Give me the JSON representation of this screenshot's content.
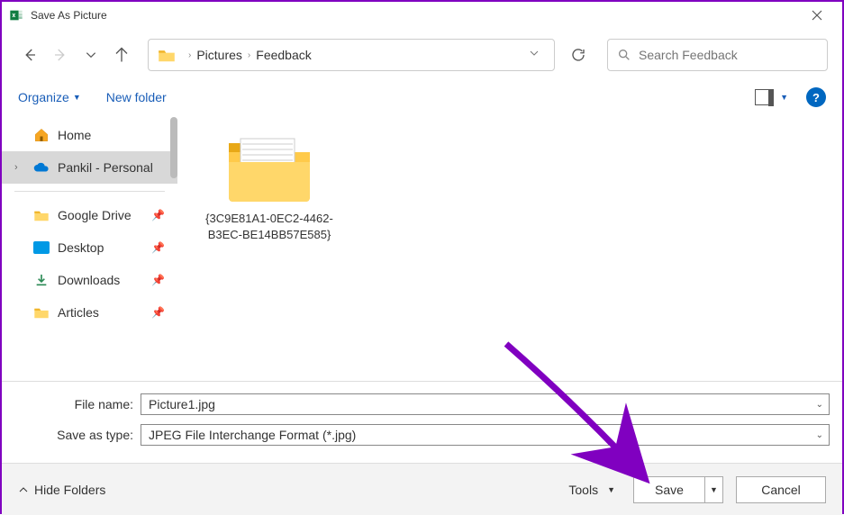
{
  "titlebar": {
    "title": "Save As Picture"
  },
  "breadcrumb": {
    "parts": [
      "Pictures",
      "Feedback"
    ]
  },
  "search": {
    "placeholder": "Search Feedback"
  },
  "toolbar": {
    "organize": "Organize",
    "new_folder": "New folder"
  },
  "sidebar": {
    "home": "Home",
    "onedrive": "Pankil - Personal",
    "gdrive": "Google Drive",
    "desktop": "Desktop",
    "downloads": "Downloads",
    "articles": "Articles"
  },
  "content": {
    "folder_name": "{3C9E81A1-0EC2-4462-B3EC-BE14BB57E585}"
  },
  "form": {
    "filename_label": "File name:",
    "filename_value": "Picture1.jpg",
    "type_label": "Save as type:",
    "type_value": "JPEG File Interchange Format (*.jpg)"
  },
  "footer": {
    "hide_folders": "Hide Folders",
    "tools": "Tools",
    "save": "Save",
    "cancel": "Cancel"
  }
}
